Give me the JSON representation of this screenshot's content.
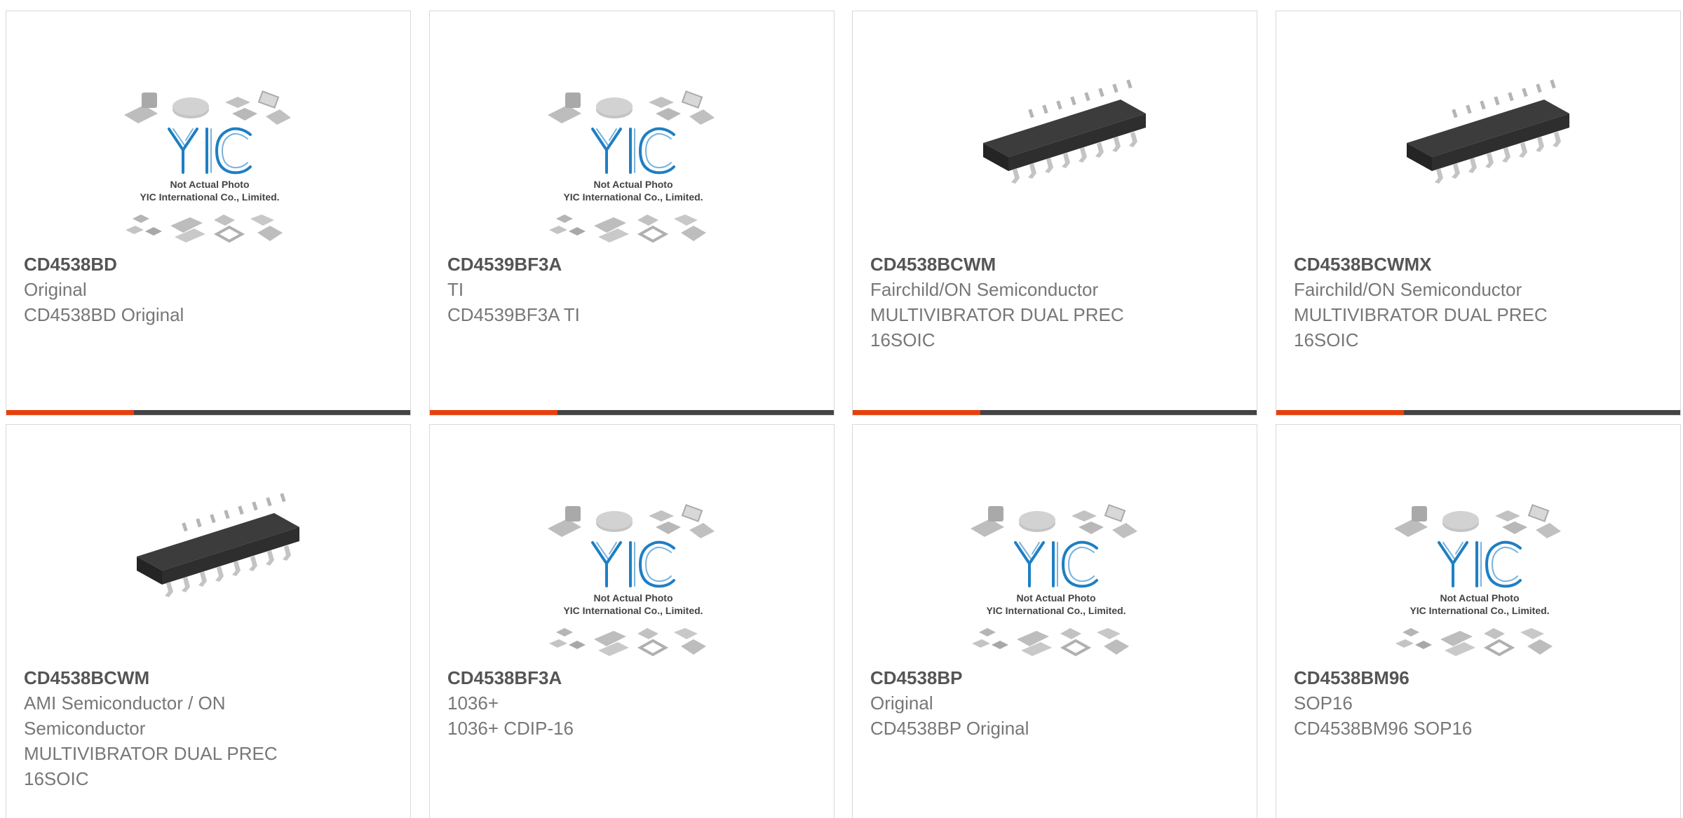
{
  "colors": {
    "accent": "#e8400c",
    "bar": "#444444",
    "logo": "#1e7fc4"
  },
  "placeholder": {
    "caption_line1": "Not Actual Photo",
    "caption_line2": "YIC International Co., Limited.",
    "logo_text": "YIC"
  },
  "products": [
    {
      "part": "CD4538BD",
      "line1": "Original",
      "line2": "CD4538BD Original",
      "image": "yic-placeholder"
    },
    {
      "part": "CD4539BF3A",
      "line1": "TI",
      "line2": "CD4539BF3A TI",
      "image": "yic-placeholder"
    },
    {
      "part": "CD4538BCWM",
      "line1": "Fairchild/ON Semiconductor",
      "line2": "MULTIVIBRATOR DUAL PREC 16SOIC",
      "image": "soic-chip"
    },
    {
      "part": "CD4538BCWMX",
      "line1": "Fairchild/ON Semiconductor",
      "line2": "MULTIVIBRATOR DUAL PREC 16SOIC",
      "image": "soic-chip"
    },
    {
      "part": "CD4538BCWM",
      "line1": "AMI Semiconductor / ON Semiconductor",
      "line2": "MULTIVIBRATOR DUAL PREC 16SOIC",
      "image": "soic-chip"
    },
    {
      "part": "CD4538BF3A",
      "line1": "1036+",
      "line2": "1036+ CDIP-16",
      "image": "yic-placeholder"
    },
    {
      "part": "CD4538BP",
      "line1": "Original",
      "line2": "CD4538BP Original",
      "image": "yic-placeholder"
    },
    {
      "part": "CD4538BM96",
      "line1": "SOP16",
      "line2": "CD4538BM96 SOP16",
      "image": "yic-placeholder"
    }
  ]
}
